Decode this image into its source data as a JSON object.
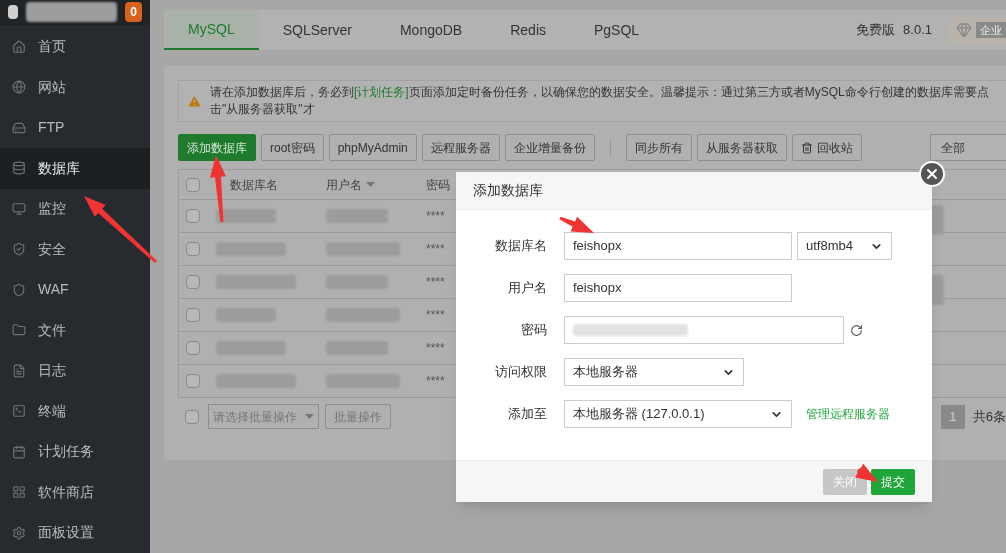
{
  "sidebar": {
    "badge": "0",
    "items": [
      {
        "label": "首页",
        "selected": false
      },
      {
        "label": "网站",
        "selected": false
      },
      {
        "label": "FTP",
        "selected": false
      },
      {
        "label": "数据库",
        "selected": true
      },
      {
        "label": "监控",
        "selected": false
      },
      {
        "label": "安全",
        "selected": false
      },
      {
        "label": "WAF",
        "selected": false
      },
      {
        "label": "文件",
        "selected": false
      },
      {
        "label": "日志",
        "selected": false
      },
      {
        "label": "终端",
        "selected": false
      },
      {
        "label": "计划任务",
        "selected": false
      },
      {
        "label": "软件商店",
        "selected": false
      },
      {
        "label": "面板设置",
        "selected": false
      }
    ]
  },
  "tabs": [
    {
      "label": "MySQL",
      "selected": true
    },
    {
      "label": "SQLServer",
      "selected": false
    },
    {
      "label": "MongoDB",
      "selected": false
    },
    {
      "label": "Redis",
      "selected": false
    },
    {
      "label": "PgSQL",
      "selected": false
    }
  ],
  "edition": {
    "label": "免费版",
    "version": "8.0.1",
    "upgrade": "企业"
  },
  "notice": {
    "before": "请在添加数据库后，务必到",
    "link": "[计划任务]",
    "after": "页面添加定时备份任务，以确保您的数据安全。温馨提示：通过第三方或者MySQL命令行创建的数据库需要点击\"从服务器获取\"才"
  },
  "toolbar": {
    "groups": [
      [
        {
          "label": "添加数据库",
          "kind": "primary"
        },
        {
          "label": "root密码",
          "kind": "default"
        },
        {
          "label": "phpMyAdmin",
          "kind": "default"
        },
        {
          "label": "远程服务器",
          "kind": "default"
        },
        {
          "label": "企业增量备份",
          "kind": "default"
        }
      ],
      [
        {
          "label": "同步所有",
          "kind": "default"
        },
        {
          "label": "从服务器获取",
          "kind": "default"
        },
        {
          "label": "回收站",
          "kind": "trash"
        }
      ]
    ],
    "filter": "全部"
  },
  "table": {
    "header_checked": false,
    "columns": [
      {
        "label": "数据库名",
        "sortable": false
      },
      {
        "label": "用户名",
        "sortable": true
      },
      {
        "label": "密码",
        "sortable": false
      }
    ],
    "rows": [
      {
        "password": "****",
        "checked": false
      },
      {
        "password": "****",
        "checked": false
      },
      {
        "password": "****",
        "checked": false
      },
      {
        "password": "****",
        "checked": false
      },
      {
        "password": "****",
        "checked": false
      },
      {
        "password": "****",
        "checked": false
      }
    ]
  },
  "footer": {
    "checked": false,
    "batch_placeholder": "请选择批量操作",
    "batch_button": "批量操作",
    "page": "1",
    "total": "共6条"
  },
  "dialog": {
    "title": "添加数据库",
    "fields": [
      {
        "kind": "input",
        "label": "数据库名",
        "value": "feishopx",
        "charset": "utf8mb4"
      },
      {
        "kind": "input",
        "label": "用户名",
        "value": "feishopx"
      },
      {
        "kind": "password",
        "label": "密码"
      },
      {
        "kind": "select",
        "label": "访问权限",
        "value": "本地服务器"
      },
      {
        "kind": "select",
        "label": "添加至",
        "value": "本地服务器 (127.0.0.1)",
        "link": "管理远程服务器"
      }
    ],
    "buttons": [
      {
        "label": "关闭",
        "kind": "secondary"
      },
      {
        "label": "提交",
        "kind": "primary"
      }
    ]
  }
}
